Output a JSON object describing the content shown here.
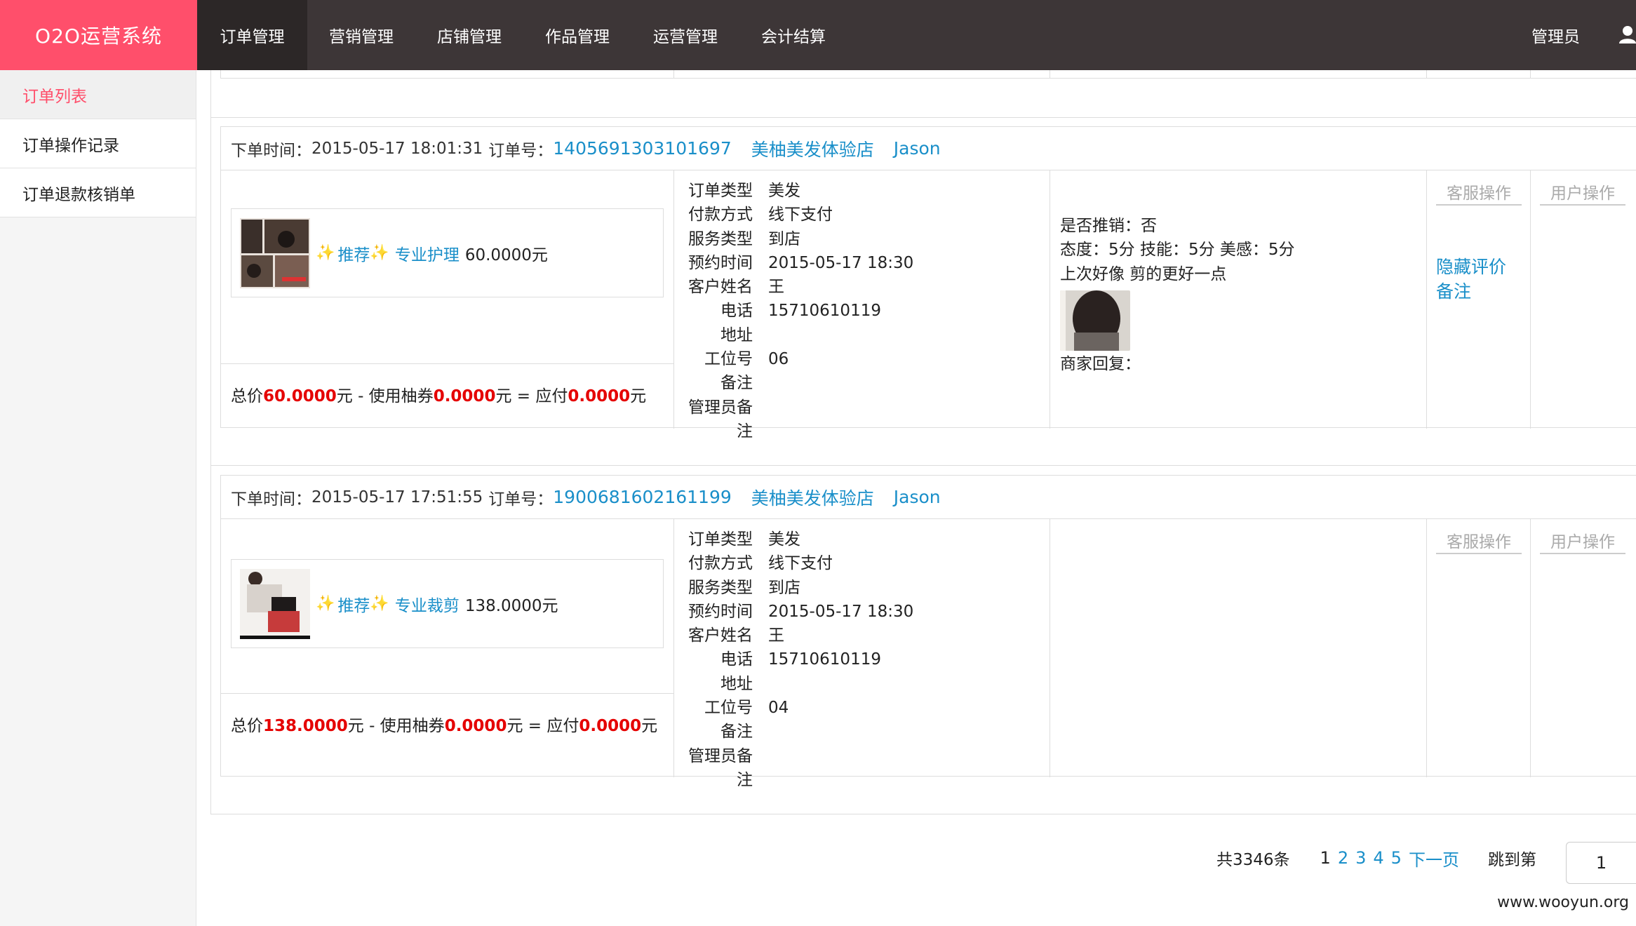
{
  "brand": "O2O运营系统",
  "nav": [
    "订单管理",
    "营销管理",
    "店铺管理",
    "作品管理",
    "运营管理",
    "会计结算"
  ],
  "admin_label": "管理员",
  "sidebar": [
    "订单列表",
    "订单操作记录",
    "订单退款核销单"
  ],
  "labels": {
    "order_time": "下单时间：",
    "order_no": "订单号：",
    "kefu_op": "客服操作",
    "user_op": "用户操作",
    "total": "总价",
    "yuan": "元",
    "use_coupon": " - 使用柚券",
    "payable": " = 应付",
    "info_keys": [
      "订单类型",
      "付款方式",
      "服务类型",
      "预约时间",
      "客户姓名",
      "电话",
      "地址",
      "工位号",
      "备注",
      "管理员备注"
    ],
    "recommend": "推荐",
    "hide_review": "隐藏评价",
    "remark": "备注"
  },
  "orders": [
    {
      "time": "2015-05-17 18:01:31",
      "order_no": "1405691303101697",
      "shop": "美柚美发体验店",
      "stylist": "Jason",
      "product": "专业护理",
      "price": "60.0000元",
      "total": "60.0000",
      "coupon": "0.0000",
      "payable": "0.0000",
      "info": {
        "order_type": "美发",
        "pay_method": "线下支付",
        "service_type": "到店",
        "appoint_time": "2015-05-17 18:30",
        "customer": "王",
        "phone": "15710610119",
        "address": "",
        "station": "06",
        "note": "",
        "admin_note": ""
      },
      "review": {
        "recommend": "是否推销：否",
        "scores": "态度：5分 技能：5分 美感：5分",
        "comment": "上次好像 剪的更好一点",
        "reply": "商家回复："
      }
    },
    {
      "time": "2015-05-17 17:51:55",
      "order_no": "1900681602161199",
      "shop": "美柚美发体验店",
      "stylist": "Jason",
      "product": "专业裁剪",
      "price": "138.0000元",
      "total": "138.0000",
      "coupon": "0.0000",
      "payable": "0.0000",
      "info": {
        "order_type": "美发",
        "pay_method": "线下支付",
        "service_type": "到店",
        "appoint_time": "2015-05-17 18:30",
        "customer": "王",
        "phone": "15710610119",
        "address": "",
        "station": "04",
        "note": "",
        "admin_note": ""
      }
    }
  ],
  "pagination": {
    "total": "共3346条",
    "current": "1",
    "pages": [
      "2",
      "3",
      "4",
      "5"
    ],
    "next": "下一页",
    "jump_label": "跳到第",
    "jump_value": "1"
  },
  "watermark": "www.wooyun.org",
  "colors": {
    "brand": "#ff4f6b",
    "topbar": "#3d3637",
    "link": "#1a8fc9",
    "price_red": "#e50000"
  }
}
